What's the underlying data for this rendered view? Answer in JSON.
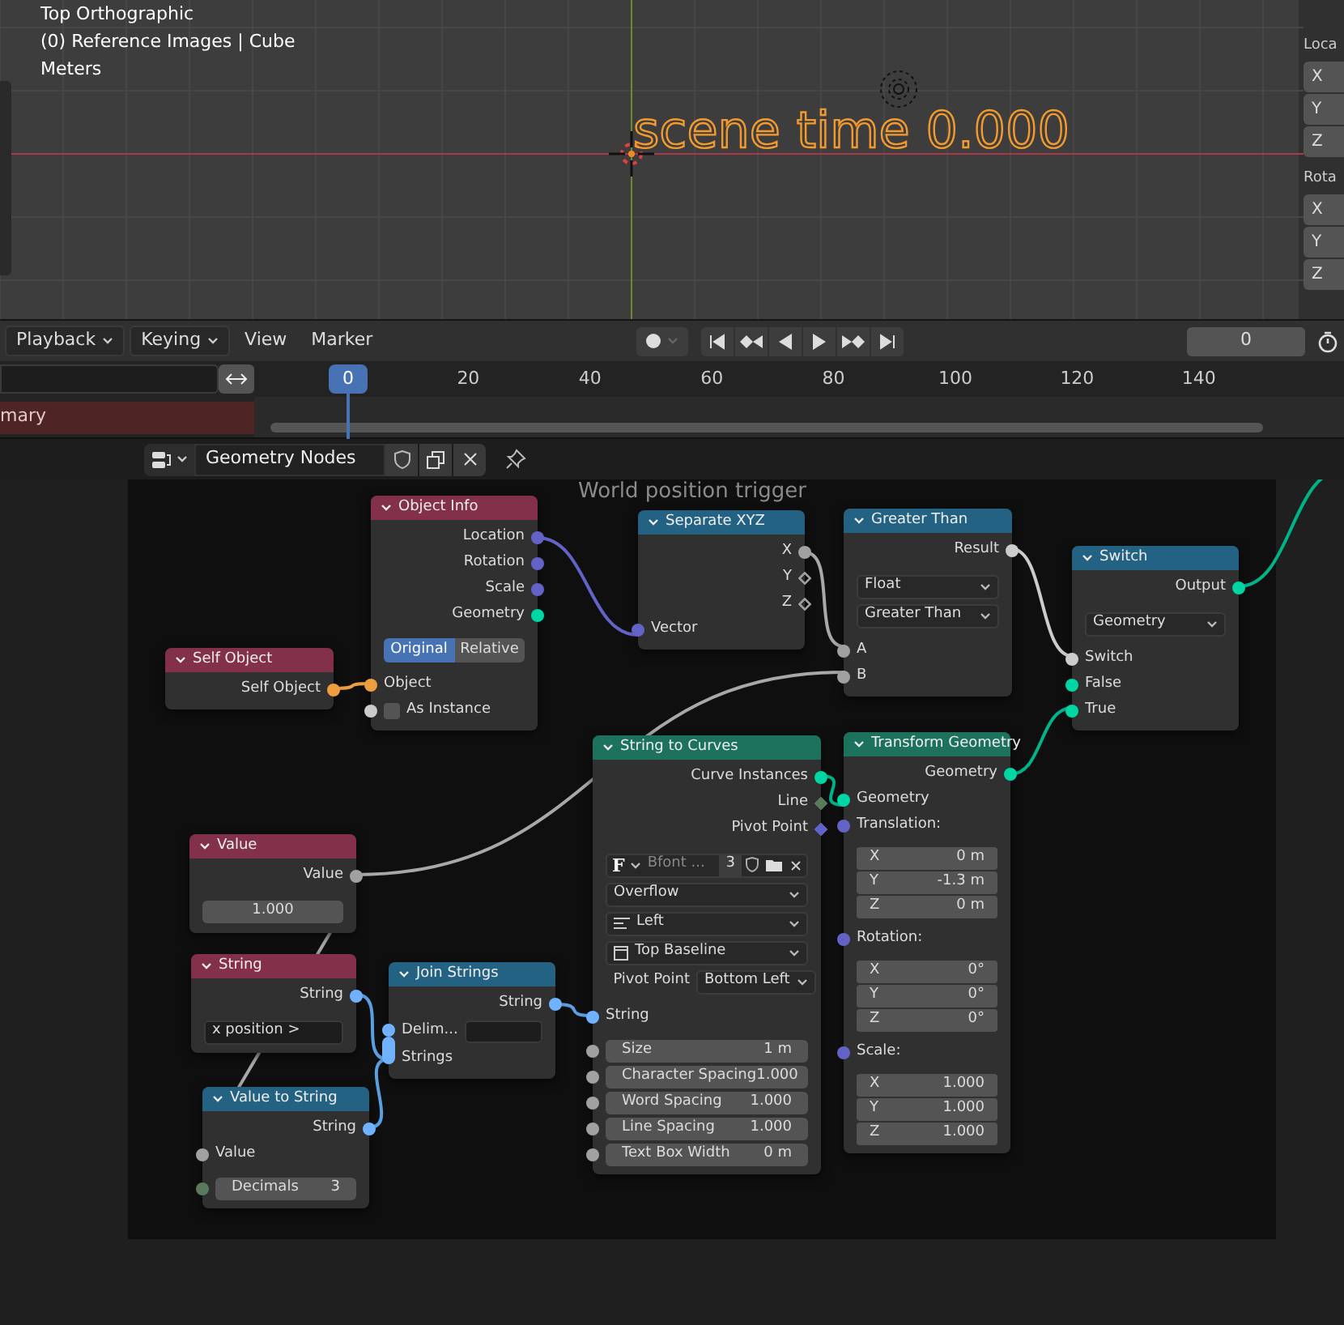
{
  "viewport": {
    "overlay_lines": [
      "Top Orthographic",
      "(0) Reference Images | Cube",
      "Meters"
    ],
    "scene_text": "scene time 0.000",
    "side_panel": [
      {
        "label": "Loca",
        "fields": [
          "X",
          "Y",
          "Z"
        ]
      },
      {
        "label": "Rota",
        "fields": [
          "X",
          "Y",
          "Z"
        ]
      }
    ]
  },
  "timeline": {
    "menus": [
      {
        "label": "Playback",
        "dropdown": true
      },
      {
        "label": "Keying",
        "dropdown": true
      },
      {
        "label": "View",
        "dropdown": false
      },
      {
        "label": "Marker",
        "dropdown": false
      }
    ],
    "current_frame": "0",
    "ruler": [
      "20",
      "40",
      "60",
      "80",
      "100",
      "120",
      "140"
    ],
    "playhead": "0",
    "track": "mary"
  },
  "node_editor": {
    "tree_name": "Geometry Nodes",
    "frame_label": "World position trigger",
    "nodes": [
      {
        "title": "Object Info",
        "color": "#83314a",
        "rows": [
          {
            "kind": "output",
            "label": "Location",
            "color": "#6363c7"
          },
          {
            "kind": "output",
            "label": "Rotation",
            "color": "#6363c7"
          },
          {
            "kind": "output",
            "label": "Scale",
            "color": "#6363c7"
          },
          {
            "kind": "output",
            "label": "Geometry",
            "color": "#00d6a3"
          },
          {
            "kind": "toggle",
            "options": [
              {
                "label": "Original",
                "selected": true
              },
              {
                "label": "Relative",
                "selected": false
              }
            ]
          },
          {
            "kind": "input",
            "label": "Object",
            "color": "#ed9e40"
          },
          {
            "kind": "checkbox",
            "label": "As Instance",
            "checked": false,
            "color": "#cccccc"
          }
        ]
      },
      {
        "title": "Self Object",
        "color": "#83314a",
        "rows": [
          {
            "kind": "output",
            "label": "Self Object",
            "color": "#ed9e40"
          }
        ]
      },
      {
        "title": "Separate XYZ",
        "color": "#246283",
        "rows": [
          {
            "kind": "output",
            "label": "X",
            "color": "#a1a1a1"
          },
          {
            "kind": "field_output",
            "label": "Y",
            "color": "#a1a1a1"
          },
          {
            "kind": "field_output",
            "label": "Z",
            "color": "#a1a1a1"
          },
          {
            "kind": "input",
            "label": "Vector",
            "color": "#6363c7"
          }
        ]
      },
      {
        "title": "Greater Than",
        "color": "#246283",
        "rows": [
          {
            "kind": "output",
            "label": "Result",
            "color": "#cccccc"
          },
          {
            "kind": "dropdown",
            "value": "Float"
          },
          {
            "kind": "dropdown",
            "value": "Greater Than"
          },
          {
            "kind": "input",
            "label": "A",
            "color": "#a1a1a1"
          },
          {
            "kind": "input",
            "label": "B",
            "color": "#a1a1a1"
          }
        ]
      },
      {
        "title": "Switch",
        "color": "#246283",
        "rows": [
          {
            "kind": "output",
            "label": "Output",
            "color": "#00d6a3"
          },
          {
            "kind": "dropdown",
            "value": "Geometry"
          },
          {
            "kind": "input",
            "label": "Switch",
            "color": "#cccccc"
          },
          {
            "kind": "input",
            "label": "False",
            "color": "#00d6a3"
          },
          {
            "kind": "input",
            "label": "True",
            "color": "#00d6a3"
          }
        ]
      },
      {
        "title": "String to Curves",
        "color": "#1d725e",
        "rows": [
          {
            "kind": "output",
            "label": "Curve Instances",
            "color": "#00d6a3"
          },
          {
            "kind": "diamond_output",
            "label": "Line",
            "color": "#5a7a5c"
          },
          {
            "kind": "diamond_output",
            "label": "Pivot Point",
            "color": "#6363c7"
          },
          {
            "kind": "font",
            "glyph": "F",
            "name": "Bfont ...",
            "users": "3"
          },
          {
            "kind": "dropdown",
            "value": "Overflow"
          },
          {
            "kind": "dropdown",
            "value": "Left"
          },
          {
            "kind": "dropdown",
            "value": "Top Baseline"
          },
          {
            "kind": "labeled_dropdown",
            "label": "Pivot Point",
            "value": "Bottom Left"
          },
          {
            "kind": "input",
            "label": "String",
            "color": "#70b2ff"
          },
          {
            "kind": "field",
            "label": "Size",
            "value": "1 m",
            "color": "#a1a1a1"
          },
          {
            "kind": "field",
            "label": "Character Spacing",
            "value": "1.000",
            "color": "#a1a1a1"
          },
          {
            "kind": "field",
            "label": "Word Spacing",
            "value": "1.000",
            "color": "#a1a1a1"
          },
          {
            "kind": "field",
            "label": "Line Spacing",
            "value": "1.000",
            "color": "#a1a1a1"
          },
          {
            "kind": "field",
            "label": "Text Box Width",
            "value": "0 m",
            "color": "#a1a1a1"
          }
        ]
      },
      {
        "title": "Transform Geometry",
        "color": "#1d725e",
        "rows": [
          {
            "kind": "output",
            "label": "Geometry",
            "color": "#00d6a3"
          },
          {
            "kind": "input",
            "label": "Geometry",
            "color": "#00d6a3"
          },
          {
            "kind": "input",
            "label": "Translation:",
            "color": "#6363c7"
          },
          {
            "kind": "vector",
            "items": [
              {
                "label": "X",
                "value": "0 m"
              },
              {
                "label": "Y",
                "value": "-1.3 m"
              },
              {
                "label": "Z",
                "value": "0 m"
              }
            ]
          },
          {
            "kind": "input",
            "label": "Rotation:",
            "color": "#6363c7"
          },
          {
            "kind": "vector",
            "items": [
              {
                "label": "X",
                "value": "0°"
              },
              {
                "label": "Y",
                "value": "0°"
              },
              {
                "label": "Z",
                "value": "0°"
              }
            ]
          },
          {
            "kind": "input",
            "label": "Scale:",
            "color": "#6363c7"
          },
          {
            "kind": "vector",
            "items": [
              {
                "label": "X",
                "value": "1.000"
              },
              {
                "label": "Y",
                "value": "1.000"
              },
              {
                "label": "Z",
                "value": "1.000"
              }
            ]
          }
        ]
      },
      {
        "title": "Value",
        "color": "#83314a",
        "rows": [
          {
            "kind": "output",
            "label": "Value",
            "color": "#a1a1a1"
          },
          {
            "kind": "value",
            "value": "1.000"
          }
        ]
      },
      {
        "title": "String",
        "color": "#83314a",
        "rows": [
          {
            "kind": "output",
            "label": "String",
            "color": "#70b2ff"
          },
          {
            "kind": "text_field",
            "value": "x position >"
          }
        ]
      },
      {
        "title": "Join Strings",
        "color": "#246283",
        "rows": [
          {
            "kind": "output",
            "label": "String",
            "color": "#70b2ff"
          },
          {
            "kind": "input_field",
            "label": "Delim...",
            "color": "#70b2ff"
          },
          {
            "kind": "multi_input",
            "label": "Strings",
            "color": "#70b2ff"
          }
        ]
      },
      {
        "title": "Value to String",
        "color": "#246283",
        "rows": [
          {
            "kind": "output",
            "label": "String",
            "color": "#70b2ff"
          },
          {
            "kind": "input",
            "label": "Value",
            "color": "#a1a1a1"
          },
          {
            "kind": "field",
            "label": "Decimals",
            "value": "3",
            "color": "#5a7a5c"
          }
        ]
      }
    ]
  }
}
